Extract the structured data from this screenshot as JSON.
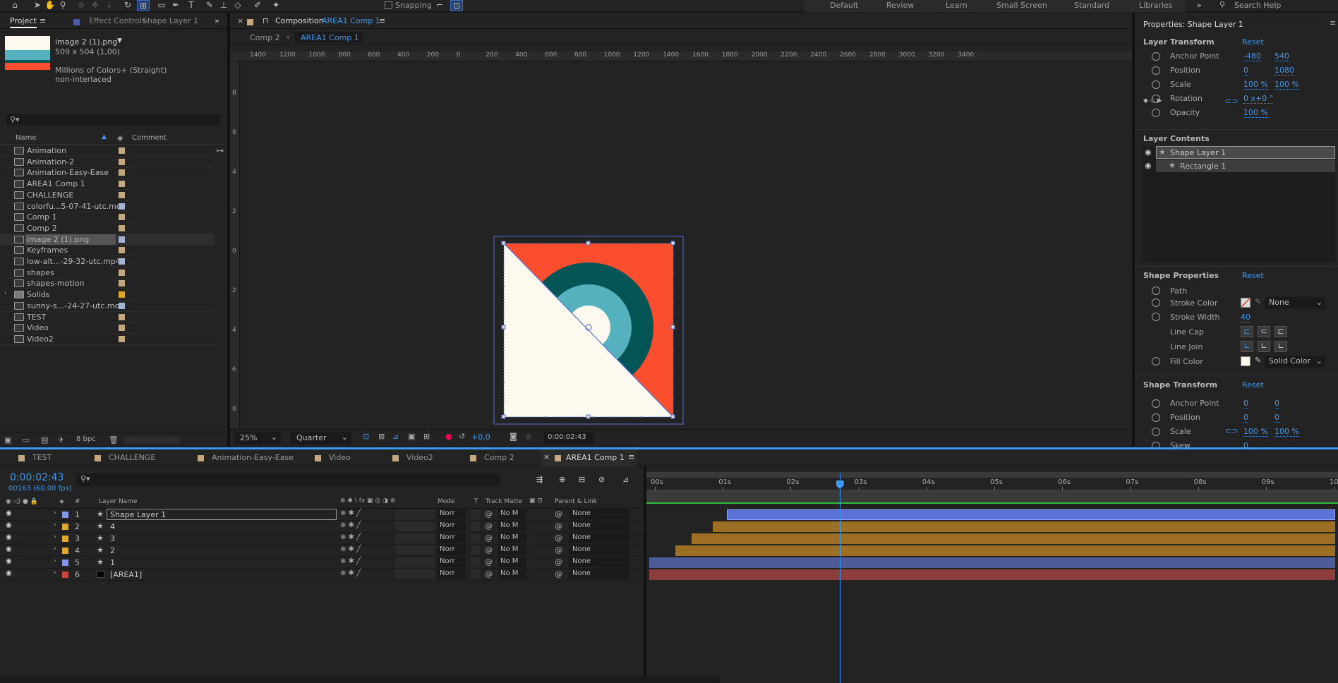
{
  "toolbar": {
    "snapping_label": "Snapping",
    "workspaces": [
      "Default",
      "Review",
      "Learn",
      "Small Screen",
      "Standard",
      "Libraries"
    ],
    "more": "»",
    "search_placeholder": "Search Help"
  },
  "project": {
    "tab_label": "Project",
    "effect_controls_label": "Effect Controls",
    "effect_controls_layer": "Shape Layer 1",
    "preview": {
      "name": "image 2 (1).png",
      "dims": "509 x 504 (1,00)",
      "colors": "Millions of Colors+ (Straight)",
      "interlace": "non-interlaced"
    },
    "columns": {
      "name": "Name",
      "comment": "Comment"
    },
    "items": [
      {
        "name": "Animation",
        "type": "comp",
        "swatch": "#c3a882"
      },
      {
        "name": "Animation-2",
        "type": "comp",
        "swatch": "#c3a882"
      },
      {
        "name": "Animation-Easy-Ease",
        "type": "comp",
        "swatch": "#c3a882"
      },
      {
        "name": "AREA1 Comp 1",
        "type": "comp",
        "swatch": "#c3a882"
      },
      {
        "name": "CHALLENGE",
        "type": "comp",
        "swatch": "#c3a882"
      },
      {
        "name": "colorfu...5-07-41-utc.mov",
        "type": "footage",
        "swatch": "#a3b3d2"
      },
      {
        "name": "Comp 1",
        "type": "comp",
        "swatch": "#c3a882"
      },
      {
        "name": "Comp 2",
        "type": "comp",
        "swatch": "#c3a882"
      },
      {
        "name": "image 2 (1).png",
        "type": "image",
        "swatch": "#a3b3d2"
      },
      {
        "name": "Keyframes",
        "type": "comp",
        "swatch": "#c3a882"
      },
      {
        "name": "low-alt...-29-32-utc.mp4",
        "type": "footage",
        "swatch": "#a3b3d2"
      },
      {
        "name": "shapes",
        "type": "comp",
        "swatch": "#c3a882"
      },
      {
        "name": "shapes-motion",
        "type": "comp",
        "swatch": "#c3a882"
      },
      {
        "name": "Solids",
        "type": "folder",
        "swatch": "#e0a82c"
      },
      {
        "name": "sunny-s...-24-27-utc.mov",
        "type": "footage",
        "swatch": "#a3b3d2"
      },
      {
        "name": "TEST",
        "type": "comp",
        "swatch": "#c3a882"
      },
      {
        "name": "Video",
        "type": "comp",
        "swatch": "#c3a882"
      },
      {
        "name": "Video2",
        "type": "comp",
        "swatch": "#c3a882"
      }
    ],
    "selected_index": 8,
    "bpc": "8 bpc"
  },
  "composition": {
    "title_prefix": "Composition",
    "title_name": "AREA1 Comp 1",
    "breadcrumb": [
      "Comp 2",
      "AREA1 Comp 1"
    ],
    "ruler": [
      "1400",
      "1200",
      "1000",
      "800",
      "600",
      "400",
      "200",
      "0",
      "200",
      "400",
      "600",
      "800",
      "1000",
      "1200",
      "1400",
      "1600",
      "1800",
      "2000",
      "2200",
      "2400",
      "2600",
      "2800",
      "3000",
      "3200",
      "3400"
    ],
    "vruler": [
      "8",
      "8",
      "4",
      "2",
      "0",
      "2",
      "4",
      "6",
      "8"
    ],
    "zoom": "25%",
    "resolution": "Quarter",
    "exposure": "+0,0",
    "timecode": "0:00:02:43",
    "colors": {
      "bg": "#fb4e2e",
      "cream": "#fdf9ee",
      "dark": "#045555",
      "teal": "#55b1bd"
    }
  },
  "properties": {
    "title": "Properties: Shape Layer 1",
    "layer_transform": {
      "heading": "Layer Transform",
      "reset": "Reset",
      "rows": [
        {
          "label": "Anchor Point",
          "v1": "-480",
          "v2": "540"
        },
        {
          "label": "Position",
          "v1": "0",
          "v2": "1080"
        },
        {
          "label": "Scale",
          "v1": "100 %",
          "v2": "100 %"
        },
        {
          "label": "Rotation",
          "v1": "0 x+0 °",
          "v2": ""
        },
        {
          "label": "Opacity",
          "v1": "100 %",
          "v2": ""
        }
      ]
    },
    "layer_contents": {
      "heading": "Layer Contents",
      "items": [
        "Shape Layer 1",
        "Rectangle 1"
      ]
    },
    "shape_properties": {
      "heading": "Shape Properties",
      "reset": "Reset",
      "path": "Path",
      "stroke_color": "Stroke Color",
      "stroke_dropdown": "None",
      "stroke_width": "Stroke Width",
      "stroke_width_value": "40",
      "line_cap": "Line Cap",
      "line_join": "Line Join",
      "fill_color": "Fill Color",
      "fill_dropdown": "Solid Color"
    },
    "shape_transform": {
      "heading": "Shape Transform",
      "reset": "Reset",
      "rows": [
        {
          "label": "Anchor Point",
          "v1": "0",
          "v2": "0"
        },
        {
          "label": "Position",
          "v1": "0",
          "v2": "0"
        },
        {
          "label": "Scale",
          "v1": "100 %",
          "v2": "100 %"
        },
        {
          "label": "Skew",
          "v1": "0",
          "v2": ""
        }
      ]
    }
  },
  "timeline": {
    "tabs": [
      {
        "name": "TEST"
      },
      {
        "name": "CHALLENGE"
      },
      {
        "name": "Animation-Easy-Ease"
      },
      {
        "name": "Video"
      },
      {
        "name": "Video2"
      },
      {
        "name": "Comp 2"
      },
      {
        "name": "AREA1 Comp 1"
      }
    ],
    "timecode": "0:00:02:43",
    "frames": "00163 (60.00 fps)",
    "columns": {
      "num": "#",
      "name": "Layer Name",
      "mode": "Mode",
      "t": "T",
      "track": "Track Matte",
      "parent": "Parent & Link"
    },
    "ruler": [
      "00s",
      "01s",
      "02s",
      "03s",
      "04s",
      "05s",
      "06s",
      "07s",
      "08s",
      "09s",
      "10"
    ],
    "layers": [
      {
        "num": "1",
        "name": "Shape Layer 1",
        "color": "#8596e8",
        "mode": "Norr",
        "matte": "No M",
        "parent": "None",
        "start": 0.114,
        "barcolor": "#5b73d8",
        "star": true
      },
      {
        "num": "2",
        "name": "4",
        "color": "#e0a82c",
        "mode": "Norr",
        "matte": "No M",
        "parent": "None",
        "start": 0.094,
        "barcolor": "#9c6f24",
        "star": true
      },
      {
        "num": "3",
        "name": "3",
        "color": "#e0a82c",
        "mode": "Norr",
        "matte": "No M",
        "parent": "None",
        "start": 0.062,
        "barcolor": "#9c6f24",
        "star": true
      },
      {
        "num": "4",
        "name": "2",
        "color": "#e0a82c",
        "mode": "Norr",
        "matte": "No M",
        "parent": "None",
        "start": 0.038,
        "barcolor": "#9c6f24",
        "star": true
      },
      {
        "num": "5",
        "name": "1",
        "color": "#8596e8",
        "mode": "Norr",
        "matte": "No M",
        "parent": "None",
        "start": 0,
        "barcolor": "#4d5b99",
        "star": true
      },
      {
        "num": "6",
        "name": "[AREA1]",
        "color": "#c8473f",
        "mode": "Norr",
        "matte": "No M",
        "parent": "None",
        "start": 0,
        "barcolor": "#8b3e3c",
        "star": false
      }
    ],
    "playhead": 0.272
  }
}
